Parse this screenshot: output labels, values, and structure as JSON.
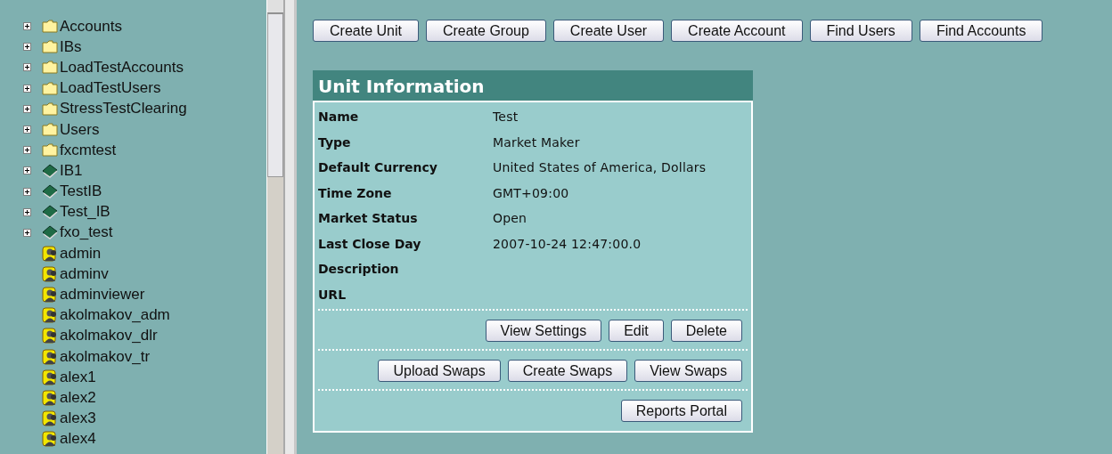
{
  "tree": {
    "items": [
      {
        "label": "Accounts",
        "kind": "folder",
        "expanded": false
      },
      {
        "label": "IBs",
        "kind": "folder",
        "expanded": false
      },
      {
        "label": "LoadTestAccounts",
        "kind": "folder",
        "expanded": false
      },
      {
        "label": "LoadTestUsers",
        "kind": "folder",
        "expanded": false
      },
      {
        "label": "StressTestClearing",
        "kind": "folder",
        "expanded": false
      },
      {
        "label": "Users",
        "kind": "folder",
        "expanded": false
      },
      {
        "label": "fxcmtest",
        "kind": "folder",
        "expanded": false
      },
      {
        "label": "IB1",
        "kind": "book",
        "expanded": false
      },
      {
        "label": "TestIB",
        "kind": "book",
        "expanded": false
      },
      {
        "label": "Test_IB",
        "kind": "book",
        "expanded": false
      },
      {
        "label": "fxo_test",
        "kind": "book",
        "expanded": false
      },
      {
        "label": "admin",
        "kind": "user"
      },
      {
        "label": "adminv",
        "kind": "user"
      },
      {
        "label": "adminviewer",
        "kind": "user"
      },
      {
        "label": "akolmakov_adm",
        "kind": "user"
      },
      {
        "label": "akolmakov_dlr",
        "kind": "user"
      },
      {
        "label": "akolmakov_tr",
        "kind": "user"
      },
      {
        "label": "alex1",
        "kind": "user"
      },
      {
        "label": "alex2",
        "kind": "user"
      },
      {
        "label": "alex3",
        "kind": "user"
      },
      {
        "label": "alex4",
        "kind": "user"
      }
    ]
  },
  "toolbar": [
    "Create Unit",
    "Create Group",
    "Create User",
    "Create Account",
    "Find Users",
    "Find Accounts"
  ],
  "unit_info": {
    "title": "Unit Information",
    "fields": [
      {
        "label": "Name",
        "value": "Test"
      },
      {
        "label": "Type",
        "value": "Market Maker"
      },
      {
        "label": "Default Currency",
        "value": "United States of America, Dollars"
      },
      {
        "label": "Time Zone",
        "value": "GMT+09:00"
      },
      {
        "label": "Market Status",
        "value": "Open"
      },
      {
        "label": "Last Close Day",
        "value": "2007-10-24 12:47:00.0"
      },
      {
        "label": "Description"
      },
      {
        "label": "URL"
      }
    ],
    "button_rows": [
      [
        "View Settings",
        "Edit",
        "Delete"
      ],
      [
        "Upload Swaps",
        "Create Swaps",
        "View Swaps"
      ],
      [
        "Reports Portal"
      ]
    ]
  }
}
